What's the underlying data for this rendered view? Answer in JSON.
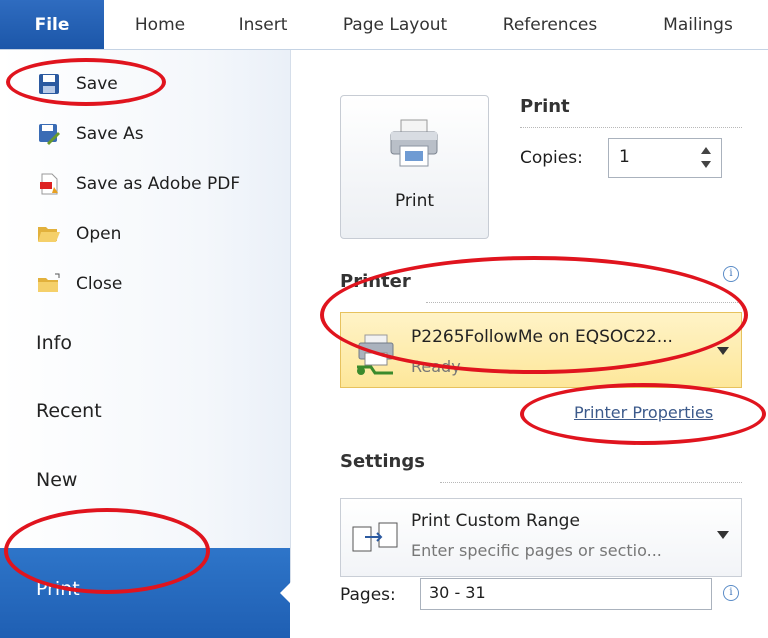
{
  "ribbon": {
    "tabs": [
      "File",
      "Home",
      "Insert",
      "Page Layout",
      "References",
      "Mailings"
    ]
  },
  "nav": {
    "commands": [
      {
        "label": "Save",
        "icon": "save-icon"
      },
      {
        "label": "Save As",
        "icon": "save-as-icon"
      },
      {
        "label": "Save as Adobe PDF",
        "icon": "adobe-pdf-icon"
      },
      {
        "label": "Open",
        "icon": "folder-open-icon"
      },
      {
        "label": "Close",
        "icon": "folder-close-icon"
      }
    ],
    "pages": [
      "Info",
      "Recent",
      "New",
      "Print"
    ],
    "selected": "Print"
  },
  "print": {
    "button_label": "Print",
    "header": "Print",
    "copies_label": "Copies:",
    "copies_value": "1"
  },
  "printer": {
    "header": "Printer",
    "name": "P2265FollowMe on EQSOC22...",
    "status": "Ready",
    "properties_link": "Printer Properties"
  },
  "settings": {
    "header": "Settings",
    "range_title": "Print Custom Range",
    "range_desc": "Enter specific pages or sectio...",
    "pages_label": "Pages:",
    "pages_value": "30 - 31"
  },
  "colors": {
    "file_tab": "#1b56a8",
    "selection": "#1f5fb3",
    "annotation": "#e0141e",
    "printer_box": "#fde79a"
  }
}
